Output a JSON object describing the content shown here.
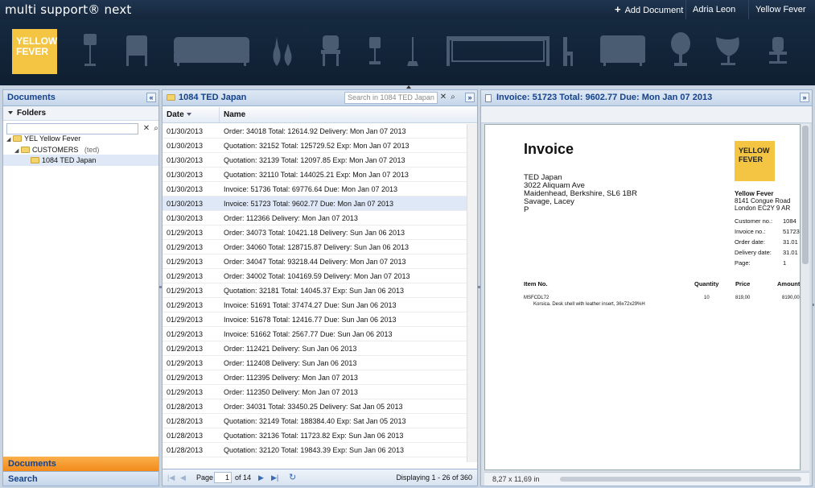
{
  "app": {
    "brand": "multi support® next",
    "add_document": "Add Document",
    "user": "Adria Leon",
    "company": "Yellow Fever"
  },
  "banner": {
    "logo_line1": "YELLOW",
    "logo_line2": "FEVER",
    "logo_color": "#f4c542"
  },
  "left": {
    "title": "Documents",
    "folders_label": "Folders",
    "search_value": "",
    "tree": [
      {
        "code": "YEL",
        "label": "Yellow Fever",
        "extra": ""
      },
      {
        "code": "",
        "label": "CUSTOMERS",
        "extra": "(ted)"
      },
      {
        "code": "",
        "label": "1084 TED Japan",
        "extra": ""
      }
    ],
    "footer_documents": "Documents",
    "footer_search": "Search"
  },
  "mid": {
    "title": "1084 TED Japan",
    "search_placeholder": "Search in 1084 TED Japan",
    "col_date": "Date",
    "col_name": "Name",
    "rows": [
      {
        "date": "01/30/2013",
        "name": "Order: 34018 Total: 12614.92 Delivery: Mon Jan 07 2013"
      },
      {
        "date": "01/30/2013",
        "name": "Quotation: 32152 Total: 125729.52 Exp: Mon Jan 07 2013"
      },
      {
        "date": "01/30/2013",
        "name": "Quotation: 32139 Total: 12097.85 Exp: Mon Jan 07 2013"
      },
      {
        "date": "01/30/2013",
        "name": "Quotation: 32110 Total: 144025.21 Exp: Mon Jan 07 2013"
      },
      {
        "date": "01/30/2013",
        "name": "Invoice: 51736 Total: 69776.64 Due: Mon Jan 07 2013"
      },
      {
        "date": "01/30/2013",
        "name": "Invoice: 51723 Total: 9602.77 Due: Mon Jan 07 2013"
      },
      {
        "date": "01/30/2013",
        "name": "Order: 112366 Delivery: Mon Jan 07 2013"
      },
      {
        "date": "01/29/2013",
        "name": "Order: 34073 Total: 10421.18 Delivery: Sun Jan 06 2013"
      },
      {
        "date": "01/29/2013",
        "name": "Order: 34060 Total: 128715.87 Delivery: Sun Jan 06 2013"
      },
      {
        "date": "01/29/2013",
        "name": "Order: 34047 Total: 93218.44 Delivery: Mon Jan 07 2013"
      },
      {
        "date": "01/29/2013",
        "name": "Order: 34002 Total: 104169.59 Delivery: Mon Jan 07 2013"
      },
      {
        "date": "01/29/2013",
        "name": "Quotation: 32181 Total: 14045.37 Exp: Sun Jan 06 2013"
      },
      {
        "date": "01/29/2013",
        "name": "Invoice: 51691 Total: 37474.27 Due: Sun Jan 06 2013"
      },
      {
        "date": "01/29/2013",
        "name": "Invoice: 51678 Total: 12416.77 Due: Sun Jan 06 2013"
      },
      {
        "date": "01/29/2013",
        "name": "Invoice: 51662 Total: 2567.77 Due: Sun Jan 06 2013"
      },
      {
        "date": "01/29/2013",
        "name": "Order: 112421 Delivery: Sun Jan 06 2013"
      },
      {
        "date": "01/29/2013",
        "name": "Order: 112408 Delivery: Sun Jan 06 2013"
      },
      {
        "date": "01/29/2013",
        "name": "Order: 112395 Delivery: Mon Jan 07 2013"
      },
      {
        "date": "01/29/2013",
        "name": "Order: 112350 Delivery: Mon Jan 07 2013"
      },
      {
        "date": "01/28/2013",
        "name": "Order: 34031 Total: 33450.25 Delivery: Sat Jan 05 2013"
      },
      {
        "date": "01/28/2013",
        "name": "Quotation: 32149 Total: 188384.40 Exp: Sat Jan 05 2013"
      },
      {
        "date": "01/28/2013",
        "name": "Quotation: 32136 Total: 11723.82 Exp: Sun Jan 06 2013"
      },
      {
        "date": "01/28/2013",
        "name": "Quotation: 32120 Total: 19843.39 Exp: Sun Jan 06 2013"
      }
    ],
    "selected_row": 5,
    "pager": {
      "page_label": "Page",
      "page_value": "1",
      "of_label": "of 14",
      "displaying": "Displaying 1 - 26 of 360"
    }
  },
  "right": {
    "title": "Invoice: 51723 Total: 9602.77 Due: Mon Jan 07 2013",
    "status": "8,27 x 11,69 in",
    "invoice": {
      "heading": "Invoice",
      "logo_line1": "YELLOW",
      "logo_line2": "FEVER",
      "addr1": "TED Japan",
      "addr2": "3022 Aliquam Ave",
      "addr3": "Maidenhead, Berkshire, SL6 1BR",
      "addr4": "Savage, Lacey",
      "addr5": "P",
      "company_name": "Yellow Fever",
      "company_addr1": "8141 Congue Road",
      "company_addr2": "London EC2Y 9 AR",
      "customer_no_label": "Customer no.:",
      "customer_no": "1084",
      "invoice_no_label": "Invoice no.:",
      "invoice_no": "51723",
      "order_date_label": "Order date:",
      "order_date": "31.01",
      "delivery_date_label": "Delivery date:",
      "delivery_date": "31.01",
      "page_label": "Page:",
      "page": "1",
      "h_item": "Item No.",
      "h_qty": "Quantity",
      "h_price": "Price",
      "h_amount": "Amount",
      "line_item": "MSFCDL72",
      "line_qty": "10",
      "line_price": "819,00",
      "line_amount": "8190,00",
      "line_desc": "Korsica. Desk shell with leather insert, 36x72x29%H"
    }
  }
}
